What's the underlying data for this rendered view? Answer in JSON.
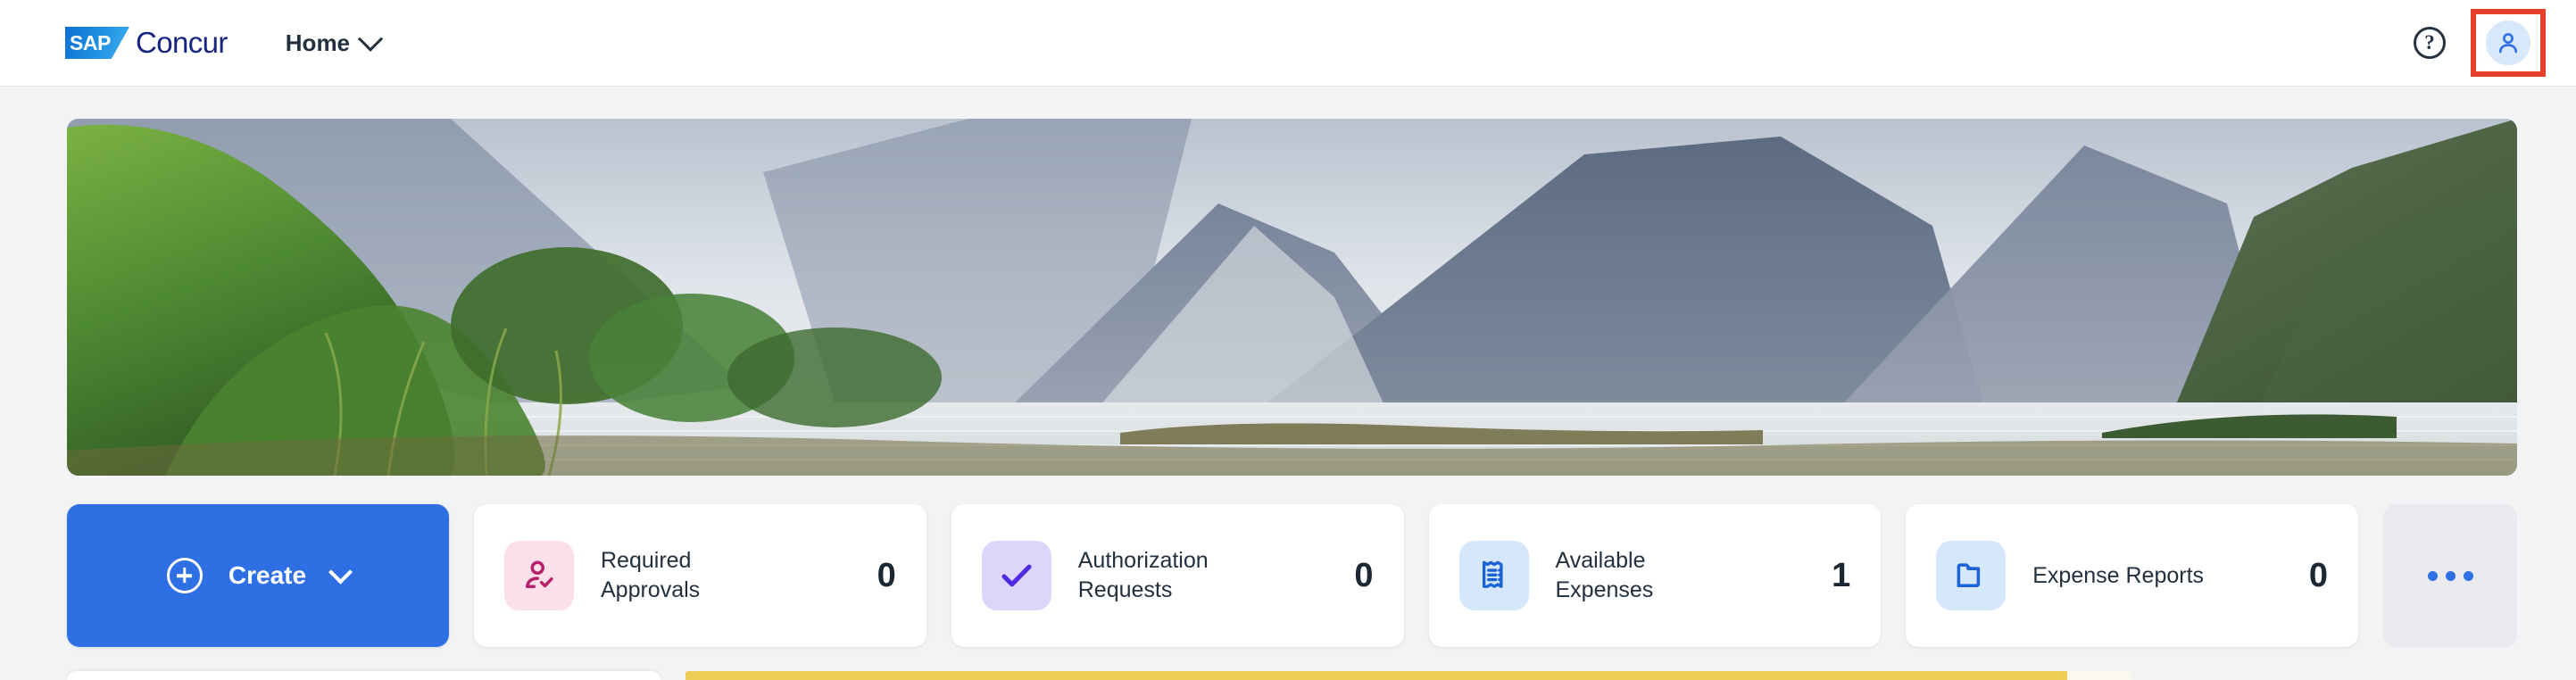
{
  "header": {
    "logo": {
      "mark_text": "SAP",
      "word": "Concur",
      "name": "sap-concur-logo"
    },
    "nav": {
      "home_label": "Home",
      "chevron_icon": "chevron-down-icon"
    },
    "help_icon": "question-mark-icon",
    "help_glyph": "?",
    "avatar_icon": "user-profile-icon",
    "avatar_highlighted": true,
    "highlight_color": "#e8402a"
  },
  "hero": {
    "name": "hero-banner-image",
    "description": "Milford Sound fjord landscape with green foliage, misty grey mountain cliffs and calm water"
  },
  "actions": {
    "create": {
      "label": "Create",
      "plus_icon": "plus-circle-icon",
      "chevron_icon": "chevron-down-icon",
      "color": "#2f6fe4"
    },
    "more": {
      "icon": "ellipsis-icon",
      "label": ""
    }
  },
  "stat_cards": [
    {
      "label": "Required Approvals",
      "value": "0",
      "icon": "user-check-icon",
      "tile_bg": "#fbdfe9",
      "icon_color": "#b5206a"
    },
    {
      "label": "Authorization Requests",
      "value": "0",
      "icon": "check-mark-icon",
      "tile_bg": "#ddd6fb",
      "icon_color": "#4f2ae0"
    },
    {
      "label": "Available Expenses",
      "value": "1",
      "icon": "receipt-icon",
      "tile_bg": "#d5e8fb",
      "icon_color": "#1a62d6"
    },
    {
      "label": "Expense Reports",
      "value": "0",
      "icon": "folder-icon",
      "tile_bg": "#d5e8fb",
      "icon_color": "#1a62d6"
    }
  ],
  "bottom": {
    "left_card_name": "content-card-partial",
    "right_panel_name": "alert-panel-partial",
    "accent_color": "#eecd55",
    "panel_color": "#fbf8f0"
  },
  "theme": {
    "page_bg": "#f2f3f5",
    "header_bg": "#ffffff",
    "text_dark": "#22303f",
    "brand_navy": "#16267f"
  }
}
